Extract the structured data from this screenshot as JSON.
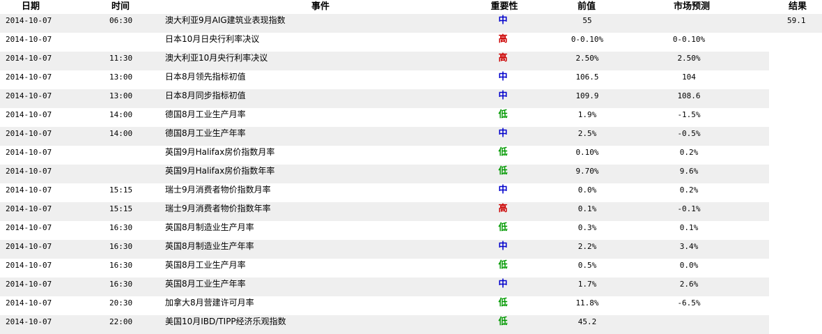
{
  "headers": {
    "date": "日期",
    "time": "时间",
    "event": "事件",
    "importance": "重要性",
    "previous": "前值",
    "forecast": "市场预测",
    "result": "结果"
  },
  "importance_colors": {
    "中": "#0000cc",
    "高": "#cc0000",
    "低": "#009900"
  },
  "rows": [
    {
      "date": "2014-10-07",
      "time": "06:30",
      "event": "澳大利亚9月AIG建筑业表现指数",
      "importance": "中",
      "previous": "55",
      "forecast": "",
      "result": "59.1"
    },
    {
      "date": "2014-10-07",
      "time": "",
      "event": "日本10月日央行利率决议",
      "importance": "高",
      "previous": "0-0.10%",
      "forecast": "0-0.10%",
      "result": ""
    },
    {
      "date": "2014-10-07",
      "time": "11:30",
      "event": "澳大利亚10月央行利率决议",
      "importance": "高",
      "previous": "2.50%",
      "forecast": "2.50%",
      "result": ""
    },
    {
      "date": "2014-10-07",
      "time": "13:00",
      "event": "日本8月领先指标初值",
      "importance": "中",
      "previous": "106.5",
      "forecast": "104",
      "result": ""
    },
    {
      "date": "2014-10-07",
      "time": "13:00",
      "event": "日本8月同步指标初值",
      "importance": "中",
      "previous": "109.9",
      "forecast": "108.6",
      "result": ""
    },
    {
      "date": "2014-10-07",
      "time": "14:00",
      "event": "德国8月工业生产月率",
      "importance": "低",
      "previous": "1.9%",
      "forecast": "-1.5%",
      "result": ""
    },
    {
      "date": "2014-10-07",
      "time": "14:00",
      "event": "德国8月工业生产年率",
      "importance": "中",
      "previous": "2.5%",
      "forecast": "-0.5%",
      "result": ""
    },
    {
      "date": "2014-10-07",
      "time": "",
      "event": "英国9月Halifax房价指数月率",
      "importance": "低",
      "previous": "0.10%",
      "forecast": "0.2%",
      "result": ""
    },
    {
      "date": "2014-10-07",
      "time": "",
      "event": "英国9月Halifax房价指数年率",
      "importance": "低",
      "previous": "9.70%",
      "forecast": "9.6%",
      "result": ""
    },
    {
      "date": "2014-10-07",
      "time": "15:15",
      "event": "瑞士9月消费者物价指数月率",
      "importance": "中",
      "previous": "0.0%",
      "forecast": "0.2%",
      "result": ""
    },
    {
      "date": "2014-10-07",
      "time": "15:15",
      "event": "瑞士9月消费者物价指数年率",
      "importance": "高",
      "previous": "0.1%",
      "forecast": "-0.1%",
      "result": ""
    },
    {
      "date": "2014-10-07",
      "time": "16:30",
      "event": "英国8月制造业生产月率",
      "importance": "低",
      "previous": "0.3%",
      "forecast": "0.1%",
      "result": ""
    },
    {
      "date": "2014-10-07",
      "time": "16:30",
      "event": "英国8月制造业生产年率",
      "importance": "中",
      "previous": "2.2%",
      "forecast": "3.4%",
      "result": ""
    },
    {
      "date": "2014-10-07",
      "time": "16:30",
      "event": "英国8月工业生产月率",
      "importance": "低",
      "previous": "0.5%",
      "forecast": "0.0%",
      "result": ""
    },
    {
      "date": "2014-10-07",
      "time": "16:30",
      "event": "英国8月工业生产年率",
      "importance": "中",
      "previous": "1.7%",
      "forecast": "2.6%",
      "result": ""
    },
    {
      "date": "2014-10-07",
      "time": "20:30",
      "event": "加拿大8月营建许可月率",
      "importance": "低",
      "previous": "11.8%",
      "forecast": "-6.5%",
      "result": ""
    },
    {
      "date": "2014-10-07",
      "time": "22:00",
      "event": "美国10月IBD/TIPP经济乐观指数",
      "importance": "低",
      "previous": "45.2",
      "forecast": "",
      "result": ""
    }
  ]
}
